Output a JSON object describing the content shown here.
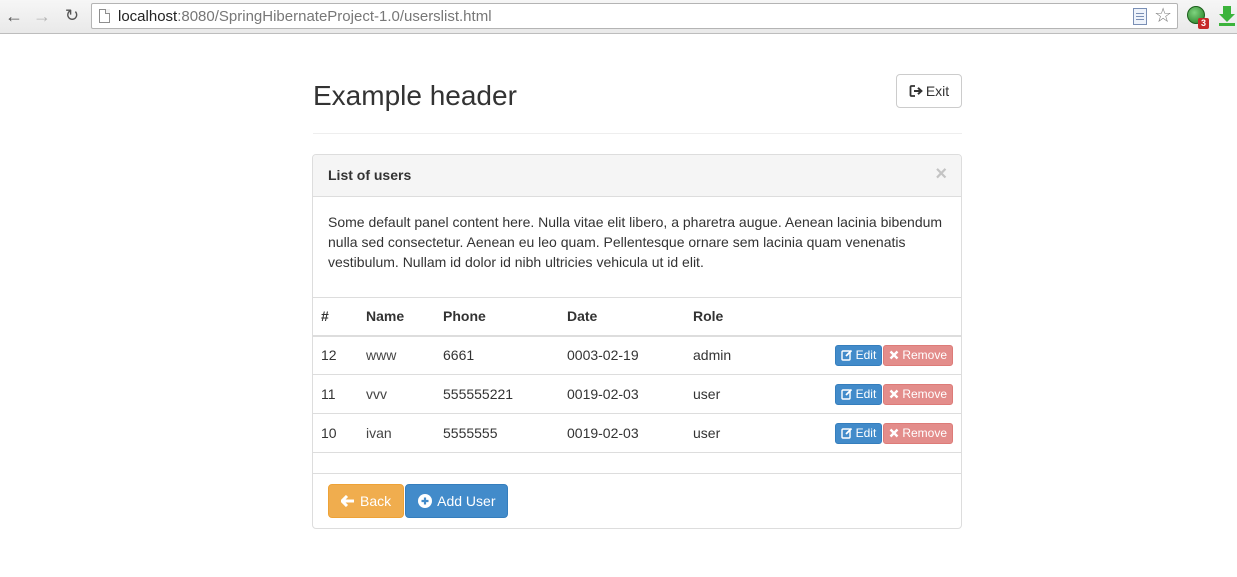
{
  "browser": {
    "url_host": "localhost",
    "url_rest": ":8080/SpringHibernateProject-1.0/userslist.html",
    "extension_badge": "3"
  },
  "header": {
    "title": "Example header",
    "exit_label": "Exit"
  },
  "panel": {
    "title": "List of users",
    "close_glyph": "×",
    "body_text": "Some default panel content here. Nulla vitae elit libero, a pharetra augue. Aenean lacinia bibendum nulla sed consectetur. Aenean eu leo quam. Pellentesque ornare sem lacinia quam venenatis vestibulum. Nullam id dolor id nibh ultricies vehicula ut id elit."
  },
  "table": {
    "headers": [
      "#",
      "Name",
      "Phone",
      "Date",
      "Role"
    ],
    "rows": [
      {
        "id": "12",
        "name": "www",
        "phone": "6661",
        "date": "0003-02-19",
        "role": "admin"
      },
      {
        "id": "11",
        "name": "vvv",
        "phone": "555555221",
        "date": "0019-02-03",
        "role": "user"
      },
      {
        "id": "10",
        "name": "ivan",
        "phone": "5555555",
        "date": "0019-02-03",
        "role": "user"
      }
    ],
    "edit_label": "Edit",
    "remove_label": "Remove"
  },
  "footer": {
    "back_label": "Back",
    "add_user_label": "Add User"
  },
  "colors": {
    "primary": "#428bca",
    "warning": "#f0ad4e",
    "danger_light": "#e38d8b"
  },
  "icons": {
    "exit": "sign-out-icon",
    "edit": "edit-icon",
    "remove": "remove-icon",
    "back": "arrow-left-icon",
    "add": "plus-circle-icon"
  }
}
